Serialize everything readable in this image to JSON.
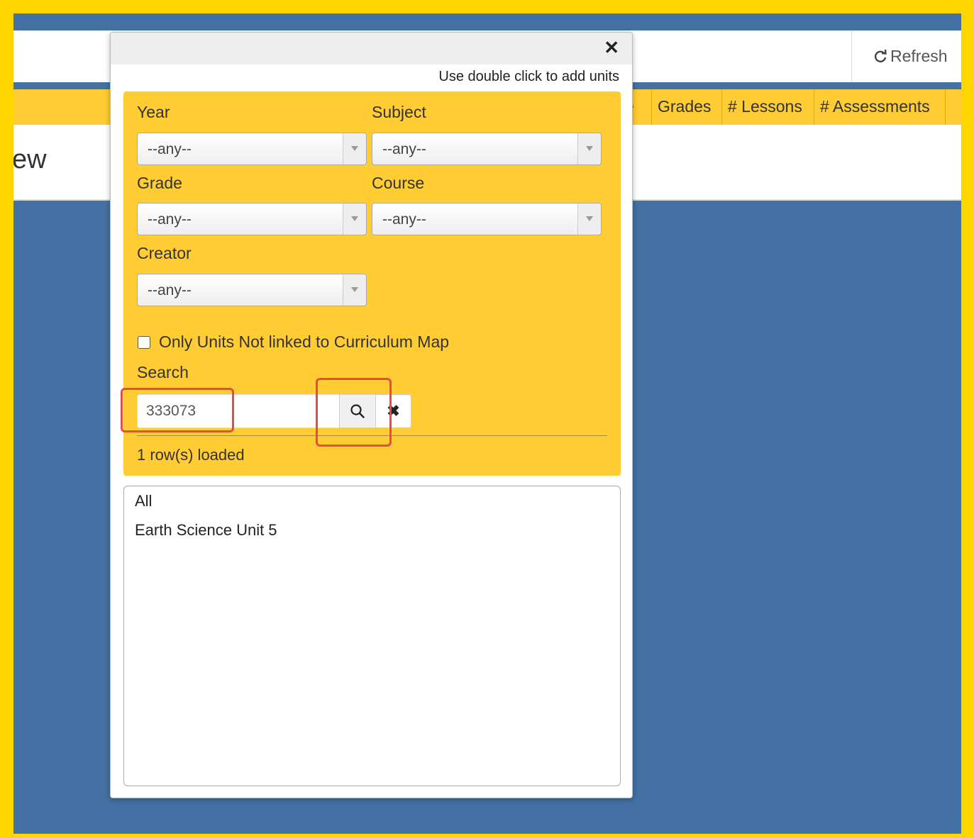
{
  "toolbar": {
    "refresh_label": "Refresh"
  },
  "grid": {
    "columns": [
      "e",
      "Grades",
      "# Lessons",
      "# Assessments"
    ]
  },
  "page": {
    "title_fragment": "ew"
  },
  "modal": {
    "hint": "Use double click to add units",
    "filters": {
      "year": {
        "label": "Year",
        "value": "--any--"
      },
      "subject": {
        "label": "Subject",
        "value": "--any--"
      },
      "grade": {
        "label": "Grade",
        "value": "--any--"
      },
      "course": {
        "label": "Course",
        "value": "--any--"
      },
      "creator": {
        "label": "Creator",
        "value": "--any--"
      }
    },
    "checkbox_label": "Only Units Not linked to Curriculum Map",
    "checkbox_checked": false,
    "search": {
      "label": "Search",
      "value": "333073"
    },
    "rows_loaded": "1 row(s) loaded",
    "results": [
      "All",
      "Earth Science Unit 5"
    ]
  },
  "colors": {
    "frame": "#FFD500",
    "page_background": "#4471a3",
    "panel": "#FFCC33",
    "highlight": "#e84a4a"
  },
  "icons": {
    "close": "close-icon",
    "search": "search-icon",
    "clear": "clear-icon",
    "refresh": "refresh-icon"
  }
}
